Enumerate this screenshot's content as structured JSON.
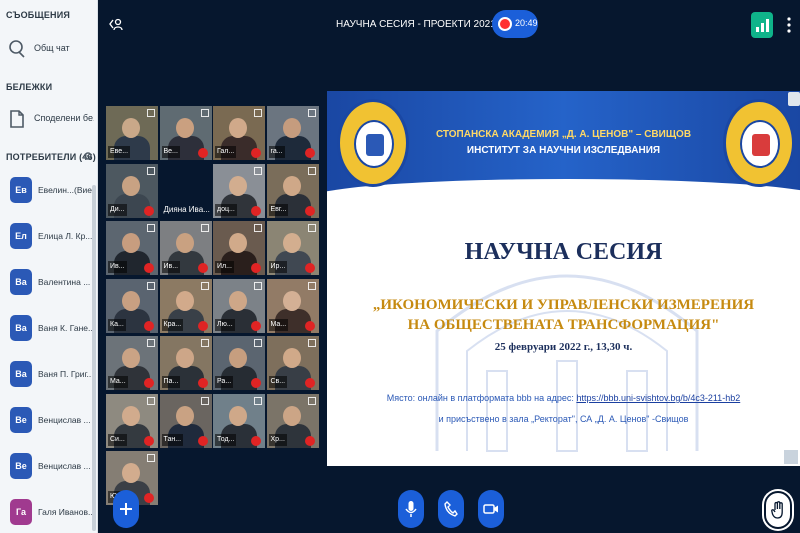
{
  "sidebar": {
    "messages_title": "СЪОБЩЕНИЯ",
    "public_chat": "Общ чат",
    "notes_title": "БЕЛЕЖКИ",
    "shared_notes": "Споделени бе...",
    "users_title": "ПОТРЕБИТЕЛИ (46)",
    "users": [
      {
        "initials": "Ев",
        "name": "Евелин...(Вие)",
        "color": "#2b59b6",
        "mic": "#0fb48a"
      },
      {
        "initials": "Ел",
        "name": "Елица Л. Кр...",
        "color": "#2b59b6",
        "mic": "#e02424"
      },
      {
        "initials": "Ва",
        "name": "Валентина ...",
        "color": "#2b59b6",
        "mic": "#0fb48a"
      },
      {
        "initials": "Ва",
        "name": "Ваня К. Гане...",
        "color": "#2b59b6",
        "mic": "#e02424"
      },
      {
        "initials": "Ва",
        "name": "Ваня П. Григ...",
        "color": "#2b59b6",
        "mic": "#e02424"
      },
      {
        "initials": "Ве",
        "name": "Венцислав ...",
        "color": "#2b59b6",
        "mic": "#e02424"
      },
      {
        "initials": "Ве",
        "name": "Венцислав ...",
        "color": "#2b59b6",
        "mic": "#e02424"
      },
      {
        "initials": "Га",
        "name": "Галя Иванов...",
        "color": "#a03a8f",
        "mic": "#e02424"
      }
    ]
  },
  "header": {
    "title": "НАУЧНА СЕСИЯ - ПРОЕКТИ 2021",
    "recording_time": "20:49"
  },
  "video_tiles": [
    {
      "name": "Еве...",
      "muted": false,
      "bg": "#6e6a56",
      "face": "#c9a889",
      "shirt": "#2e3a4a"
    },
    {
      "name": "Ве...",
      "muted": true,
      "bg": "#5f6b72",
      "face": "#caa080",
      "shirt": "#2d2f3a"
    },
    {
      "name": "Гал...",
      "muted": true,
      "bg": "#7a6a52",
      "face": "#d0a98a",
      "shirt": "#3a2c2a"
    },
    {
      "name": "ra...",
      "muted": true,
      "bg": "#6b7580",
      "face": "#c59c7e",
      "shirt": "#1e2a3a"
    },
    {
      "name": "Ди...",
      "muted": true,
      "bg": "#4d5860",
      "face": "#c8a283",
      "shirt": "#3c4650"
    },
    {
      "name": "Дияна Ива...",
      "muted": false,
      "bg": "#06172e",
      "noimg": true
    },
    {
      "name": "доц...",
      "muted": true,
      "bg": "#8a8f96",
      "face": "#d2ad8f",
      "shirt": "#30343a"
    },
    {
      "name": "Евг...",
      "muted": true,
      "bg": "#7a6d5a",
      "face": "#cfa888",
      "shirt": "#2b3038"
    },
    {
      "name": "Ив...",
      "muted": true,
      "bg": "#5c6670",
      "face": "#c79d7f",
      "shirt": "#20262e"
    },
    {
      "name": "Ив...",
      "muted": true,
      "bg": "#7d7f82",
      "face": "#c9a181",
      "shirt": "#33393f"
    },
    {
      "name": "Ил...",
      "muted": true,
      "bg": "#6a5b4f",
      "face": "#d1aa8a",
      "shirt": "#2a1f1c"
    },
    {
      "name": "Ир...",
      "muted": true,
      "bg": "#8b8574",
      "face": "#d3ae8f",
      "shirt": "#404852"
    },
    {
      "name": "Ка...",
      "muted": true,
      "bg": "#5a6470",
      "face": "#c8a082",
      "shirt": "#2c3440"
    },
    {
      "name": "Кра...",
      "muted": true,
      "bg": "#8c7a63",
      "face": "#d2aa8b",
      "shirt": "#394048"
    },
    {
      "name": "Лю...",
      "muted": true,
      "bg": "#7c8288",
      "face": "#cea788",
      "shirt": "#2a2f36"
    },
    {
      "name": "Ма...",
      "muted": true,
      "bg": "#927b66",
      "face": "#d4b095",
      "shirt": "#3e2f2a"
    },
    {
      "name": "Ма...",
      "muted": true,
      "bg": "#6c7379",
      "face": "#caa385",
      "shirt": "#2f3339"
    },
    {
      "name": "Па...",
      "muted": true,
      "bg": "#847662",
      "face": "#cda688",
      "shirt": "#2b3138"
    },
    {
      "name": "Ра...",
      "muted": true,
      "bg": "#5b6570",
      "face": "#c69e7f",
      "shirt": "#262c33"
    },
    {
      "name": "Св...",
      "muted": true,
      "bg": "#7e6f5c",
      "face": "#d0a989",
      "shirt": "#383e46"
    },
    {
      "name": "Си...",
      "muted": true,
      "bg": "#8e8a80",
      "face": "#d1ab8d",
      "shirt": "#343a40"
    },
    {
      "name": "Тан...",
      "muted": true,
      "bg": "#6a6560",
      "face": "#c9a283",
      "shirt": "#1f2a3c"
    },
    {
      "name": "Тод...",
      "muted": true,
      "bg": "#70808a",
      "face": "#cfa889",
      "shirt": "#2a3038"
    },
    {
      "name": "Хр...",
      "muted": true,
      "bg": "#7b7468",
      "face": "#cca586",
      "shirt": "#2e343b"
    },
    {
      "name": "Юл...",
      "muted": true,
      "bg": "#857e74",
      "face": "#d2ac8e",
      "shirt": "#3a3f46"
    }
  ],
  "slide": {
    "academy": "СТОПАНСКА АКАДЕМИЯ „Д. А. ЦЕНОВ\" – СВИЩОВ",
    "institute": "ИНСТИТУТ ЗА НАУЧНИ ИЗСЛЕДВАНИЯ",
    "title": "НАУЧНА СЕСИЯ",
    "subtitle_line1": "„ИКОНОМИЧЕСКИ И УПРАВЛЕНСКИ ИЗМЕРЕНИЯ",
    "subtitle_line2": "НА ОБЩЕСТВЕНАТА ТРАНСФОРМАЦИЯ\"",
    "date": "25 февруари 2022 г., 13,30 ч.",
    "place_prefix": "Място: онлайн в платформата bbb на адрес: ",
    "place_link": "https://bbb.uni-svishtov.bg/b/4c3-211-hb2",
    "hall": "и присъствено в зала „Ректорат\", СА „Д. А. Ценов\" -Свищов"
  },
  "colors": {
    "bg": "#06172e",
    "accent": "#1b5fd9",
    "success": "#0fb48a",
    "muted": "#e02424"
  }
}
